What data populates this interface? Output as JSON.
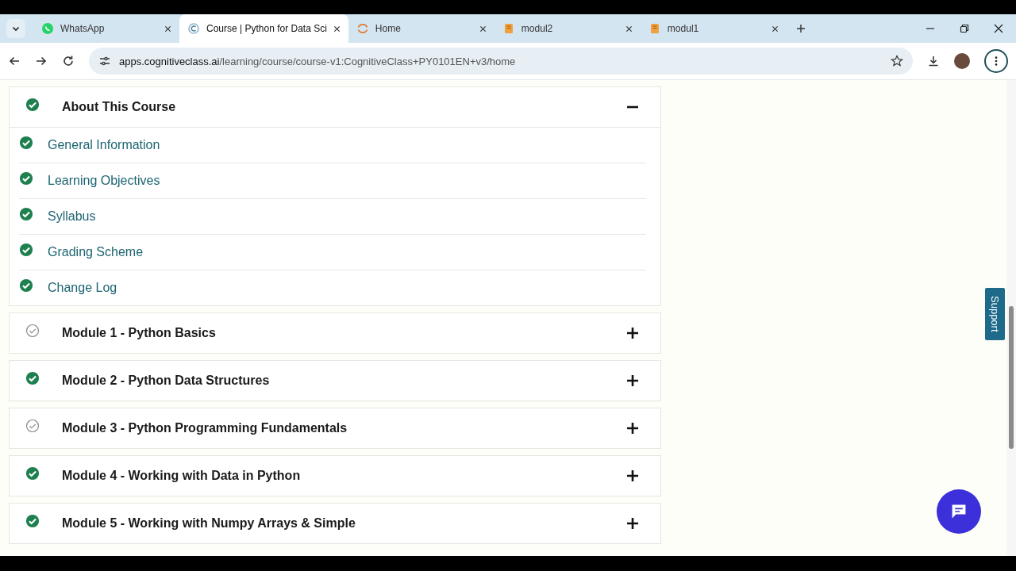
{
  "tabs": [
    {
      "title": "WhatsApp",
      "kind": "whatsapp",
      "selected": false
    },
    {
      "title": "Course | Python for Data Sci",
      "kind": "spinner",
      "selected": true
    },
    {
      "title": "Home",
      "kind": "loading",
      "selected": false
    },
    {
      "title": "modul2",
      "kind": "document",
      "selected": false
    },
    {
      "title": "modul1",
      "kind": "document",
      "selected": false
    }
  ],
  "address_bar": {
    "host": "apps.cognitiveclass.ai",
    "path": "/learning/course/course-v1:CognitiveClass+PY0101EN+v3/home"
  },
  "sections": [
    {
      "title": "About This Course",
      "completed": true,
      "expanded": true,
      "children": [
        {
          "title": "General Information",
          "completed": true
        },
        {
          "title": "Learning Objectives",
          "completed": true
        },
        {
          "title": "Syllabus",
          "completed": true
        },
        {
          "title": "Grading Scheme",
          "completed": true
        },
        {
          "title": "Change Log",
          "completed": true
        }
      ]
    },
    {
      "title": "Module 1 - Python Basics",
      "completed": false,
      "expanded": false
    },
    {
      "title": "Module 2 - Python Data Structures",
      "completed": true,
      "expanded": false
    },
    {
      "title": "Module 3 - Python Programming Fundamentals",
      "completed": false,
      "expanded": false
    },
    {
      "title": "Module 4 - Working with Data in Python",
      "completed": true,
      "expanded": false
    },
    {
      "title": "Module 5 - Working with Numpy Arrays & Simple",
      "completed": true,
      "expanded": false
    }
  ],
  "support_tab": {
    "label": "Support"
  }
}
